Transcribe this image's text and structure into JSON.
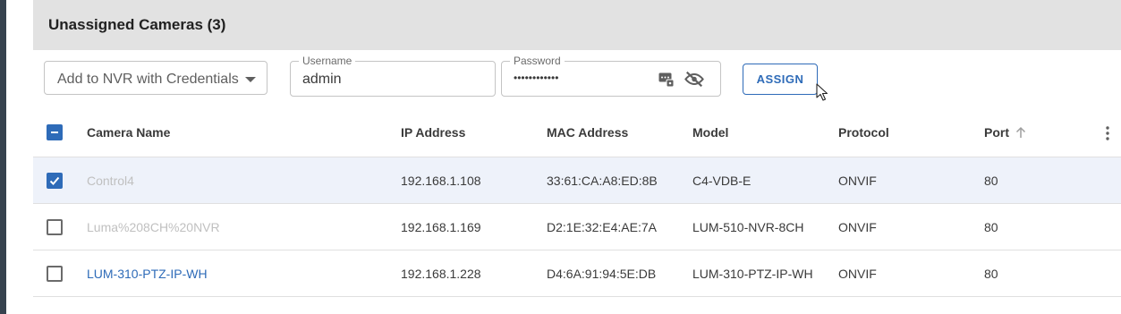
{
  "panel": {
    "title": "Unassigned Cameras (3)"
  },
  "toolbar": {
    "nvr_select_label": "Add to NVR with Credentials",
    "username_label": "Username",
    "username_value": "admin",
    "password_label": "Password",
    "password_mask": "••••••••••••",
    "assign_label": "ASSIGN"
  },
  "table": {
    "columns": [
      "Camera Name",
      "IP Address",
      "MAC Address",
      "Model",
      "Protocol",
      "Port"
    ],
    "sorted_column": "Port",
    "sort_direction": "ascending",
    "rows": [
      {
        "checked": true,
        "name": "Control4",
        "name_style": "muted",
        "ip": "192.168.1.108",
        "mac": "33:61:CA:A8:ED:8B",
        "model": "C4-VDB-E",
        "protocol": "ONVIF",
        "port": "80"
      },
      {
        "checked": false,
        "name": "Luma%208CH%20NVR",
        "name_style": "muted",
        "ip": "192.168.1.169",
        "mac": "D2:1E:32:E4:AE:7A",
        "model": "LUM-510-NVR-8CH",
        "protocol": "ONVIF",
        "port": "80"
      },
      {
        "checked": false,
        "name": "LUM-310-PTZ-IP-WH",
        "name_style": "link",
        "ip": "192.168.1.228",
        "mac": "D4:6A:91:94:5E:DB",
        "model": "LUM-310-PTZ-IP-WH",
        "protocol": "ONVIF",
        "port": "80"
      }
    ]
  },
  "colors": {
    "accent": "#2e6bb8",
    "header_bg": "#e2e2e2",
    "selected_row_bg": "#eef2fa",
    "left_rail": "#37434f"
  },
  "icons": {
    "select_arrow": "chevron-down-icon",
    "password_key": "password-key-icon",
    "visibility": "visibility-off-icon",
    "sort": "arrow-up-icon",
    "more": "more-vert-icon"
  }
}
